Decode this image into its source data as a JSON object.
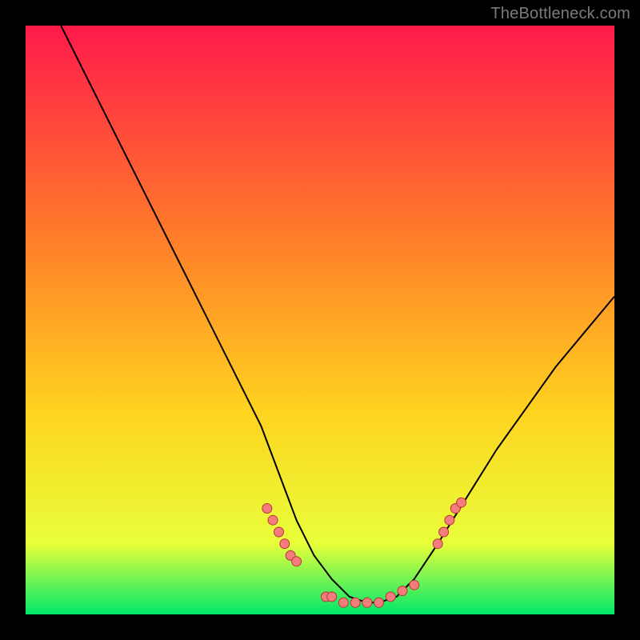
{
  "watermark": "TheBottleneck.com",
  "colors": {
    "gradient_top": "#ff1a4b",
    "gradient_mid": "#ffd21f",
    "gradient_bottom": "#00e86b",
    "curve": "#000000",
    "marker_fill": "#f47c7c",
    "marker_stroke": "#b53535",
    "background": "#000000"
  },
  "chart_data": {
    "type": "line",
    "title": "",
    "xlabel": "",
    "ylabel": "",
    "xlim": [
      0,
      100
    ],
    "ylim": [
      0,
      100
    ],
    "series": [
      {
        "name": "bottleneck-curve",
        "x": [
          6,
          10,
          15,
          20,
          25,
          30,
          35,
          40,
          43,
          46,
          49,
          52,
          55,
          58,
          60,
          63,
          66,
          70,
          75,
          80,
          85,
          90,
          95,
          100
        ],
        "y": [
          100,
          92,
          82,
          72,
          62,
          52,
          42,
          32,
          24,
          16,
          10,
          6,
          3,
          2,
          2,
          3,
          6,
          12,
          20,
          28,
          35,
          42,
          48,
          54
        ]
      }
    ],
    "markers": [
      {
        "name": "left-cluster",
        "points": [
          {
            "x": 41,
            "y": 18
          },
          {
            "x": 42,
            "y": 16
          },
          {
            "x": 43,
            "y": 14
          },
          {
            "x": 44,
            "y": 12
          },
          {
            "x": 45,
            "y": 10
          },
          {
            "x": 46,
            "y": 9
          }
        ]
      },
      {
        "name": "bottom-cluster",
        "points": [
          {
            "x": 51,
            "y": 3
          },
          {
            "x": 52,
            "y": 3
          },
          {
            "x": 54,
            "y": 2
          },
          {
            "x": 56,
            "y": 2
          },
          {
            "x": 58,
            "y": 2
          },
          {
            "x": 60,
            "y": 2
          },
          {
            "x": 62,
            "y": 3
          },
          {
            "x": 64,
            "y": 4
          },
          {
            "x": 66,
            "y": 5
          }
        ]
      },
      {
        "name": "right-cluster",
        "points": [
          {
            "x": 70,
            "y": 12
          },
          {
            "x": 71,
            "y": 14
          },
          {
            "x": 72,
            "y": 16
          },
          {
            "x": 73,
            "y": 18
          },
          {
            "x": 74,
            "y": 19
          }
        ]
      }
    ]
  }
}
